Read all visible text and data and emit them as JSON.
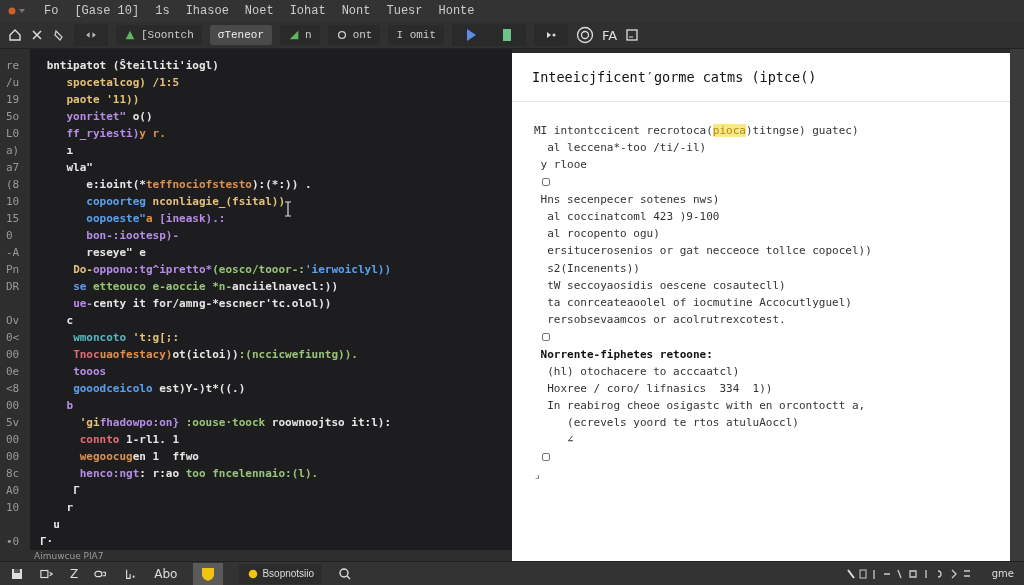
{
  "menu": [
    "Fo",
    "[Gase 10]",
    "1s",
    "Ihasoe",
    "Noet",
    "Iohat",
    "Nont",
    "Tuesr",
    "Honte"
  ],
  "toolbar": [
    {
      "label": "[Soontch",
      "selected": false
    },
    {
      "label": "σTeneor",
      "selected": true
    },
    {
      "label": "n",
      "selected": false
    },
    {
      "label": "ont",
      "selected": false
    },
    {
      "label": "I omit",
      "selected": false
    }
  ],
  "toolbar_text": "FA",
  "editor": {
    "lines": [
      {
        "gutter": "re",
        "segs": [
          {
            "t": " bntipatot (Ŝteilliti'iogl)",
            "color": "#e6e6e6"
          }
        ]
      },
      {
        "gutter": "/u",
        "segs": [
          {
            "t": "    spocetalcog) /1:5",
            "color": "#e5c07b"
          }
        ]
      },
      {
        "gutter": "19",
        "segs": [
          {
            "t": "    paote '11))",
            "color": "#e5c07b"
          }
        ]
      },
      {
        "gutter": "5o",
        "segs": [
          {
            "t": "    yonritet\"",
            "color": "#b58ce6"
          },
          {
            "t": " o()",
            "color": "#e6e6e6"
          }
        ]
      },
      {
        "gutter": "L0",
        "segs": [
          {
            "t": "    ff_ryiesti)",
            "color": "#b58ce6"
          },
          {
            "t": "y r.",
            "color": "#e0904a"
          }
        ]
      },
      {
        "gutter": "a)",
        "segs": [
          {
            "t": "    ı",
            "color": "#e6e6e6"
          }
        ]
      },
      {
        "gutter": "a7",
        "segs": [
          {
            "t": "    wla\"",
            "color": "#e6e6e6"
          }
        ]
      },
      {
        "gutter": "(8",
        "segs": [
          {
            "t": "       e:ioint(*",
            "color": "#e6e6e6"
          },
          {
            "t": "teffnociofstesto",
            "color": "#e0904a"
          },
          {
            "t": "):(*:)) .",
            "color": "#e6e6e6"
          }
        ]
      },
      {
        "gutter": "10",
        "segs": [
          {
            "t": "       copoorteg ",
            "color": "#5aa0f0"
          },
          {
            "t": "nconliagie_(fsital))",
            "color": "#e5c07b"
          }
        ]
      },
      {
        "gutter": "15",
        "segs": [
          {
            "t": "       oopoeste\"",
            "color": "#5aa0f0"
          },
          {
            "t": "a ",
            "color": "#e0904a"
          },
          {
            "t": "[ineask).:",
            "color": "#b58ce6"
          }
        ]
      },
      {
        "gutter": "0",
        "segs": [
          {
            "t": "       bon-:iootesp)-",
            "color": "#b58ce6"
          }
        ]
      },
      {
        "gutter": "-A",
        "segs": [
          {
            "t": "       reseye\" e",
            "color": "#e6e6e6"
          }
        ]
      },
      {
        "gutter": "Pn",
        "segs": [
          {
            "t": "     Do-",
            "color": "#e5c07b"
          },
          {
            "t": "oppono:tg^ipretto*",
            "color": "#b58ce6"
          },
          {
            "t": "(eosco/tooor-:",
            "color": "#98c379"
          },
          {
            "t": "'ierwoiclyl))",
            "color": "#5aa0f0"
          }
        ]
      },
      {
        "gutter": "DR",
        "segs": [
          {
            "t": "     se ",
            "color": "#5aa0f0"
          },
          {
            "t": "etteouco e-aoccie *n-",
            "color": "#98c379"
          },
          {
            "t": "anciielnavecl:))",
            "color": "#e6e6e6"
          }
        ]
      },
      {
        "segs": [
          {
            "t": "     ue-",
            "color": "#b58ce6"
          },
          {
            "t": "centy it for/amng-*escnecr'tc.olol))",
            "color": "#e6e6e6"
          }
        ]
      },
      {
        "gutter": "Ov",
        "segs": [
          {
            "t": "    c",
            "color": "#e6e6e6"
          }
        ]
      },
      {
        "gutter": "0<",
        "segs": [
          {
            "t": "     wmoncoto ",
            "color": "#56b6c2"
          },
          {
            "t": "'t:g[;:",
            "color": "#e5c07b"
          }
        ]
      },
      {
        "gutter": "00",
        "segs": [
          {
            "t": "     Tnoc",
            "color": "#e06c75"
          },
          {
            "t": "uaofestacy)",
            "color": "#e0904a"
          },
          {
            "t": "ot(icloi))",
            "color": "#e6e6e6"
          },
          {
            "t": ":(nccicwefiuntg)).",
            "color": "#98c379"
          }
        ]
      },
      {
        "gutter": "0e",
        "segs": [
          {
            "t": "     tooos",
            "color": "#b58ce6"
          }
        ]
      },
      {
        "gutter": "<8",
        "segs": [
          {
            "t": "     gooodceicolo ",
            "color": "#5aa0f0"
          },
          {
            "t": "est)Y-)t*((.)",
            "color": "#e6e6e6"
          }
        ]
      },
      {
        "gutter": "00",
        "segs": [
          {
            "t": "    b",
            "color": "#b58ce6"
          }
        ]
      },
      {
        "gutter": "5v",
        "segs": [
          {
            "t": "      'gi",
            "color": "#e5c07b"
          },
          {
            "t": "fhadowpo:on} ",
            "color": "#b58ce6"
          },
          {
            "t": ":oouse·toock ",
            "color": "#98c379"
          },
          {
            "t": "roownoojtso it:l):",
            "color": "#e6e6e6"
          }
        ]
      },
      {
        "gutter": "00",
        "segs": [
          {
            "t": "      connto ",
            "color": "#e06c75"
          },
          {
            "t": "1-rl1. 1",
            "color": "#e6e6e6"
          }
        ]
      },
      {
        "gutter": "00",
        "segs": [
          {
            "t": "      wegoocug",
            "color": "#e0904a"
          },
          {
            "t": "en 1  ffwo",
            "color": "#e6e6e6"
          }
        ]
      },
      {
        "gutter": "8c",
        "segs": [
          {
            "t": "      henco:ngt",
            "color": "#b58ce6"
          },
          {
            "t": ": r:ao ",
            "color": "#e6e6e6"
          },
          {
            "t": "too fncelennaio:(l).",
            "color": "#98c379"
          }
        ]
      },
      {
        "gutter": "A0",
        "segs": [
          {
            "t": "     Γ",
            "color": "#e6e6e6"
          }
        ]
      },
      {
        "gutter": "10",
        "segs": [
          {
            "t": "    r",
            "color": "#e6e6e6"
          }
        ]
      },
      {
        "segs": [
          {
            "t": "  u",
            "color": "#e6e6e6"
          }
        ]
      },
      {
        "gutter": "•0",
        "segs": [
          {
            "t": "Γ·",
            "color": "#e6e6e6"
          }
        ]
      }
    ],
    "status": "Aimuwcue PIA7"
  },
  "panel": {
    "title": "Inteeicjficent′gorme catms  (iptce()",
    "lines": [
      {
        "kind": "text",
        "segs": [
          {
            "t": "MI intontccicent recrotoca(",
            "highlighted": false
          },
          {
            "t": "pioca",
            "highlighted": true
          },
          {
            "t": ")titngse) guatec)",
            "highlighted": false
          }
        ]
      },
      {
        "kind": "text",
        "segs": [
          {
            "t": "  al leccena*-too /ti/-il)",
            "highlighted": false
          }
        ]
      },
      {
        "kind": "text",
        "segs": [
          {
            "t": " y rlooe",
            "highlighted": false
          }
        ]
      },
      {
        "kind": "box"
      },
      {
        "kind": "text",
        "segs": [
          {
            "t": " Hns secenpecer sotenes nws)",
            "highlighted": false
          }
        ]
      },
      {
        "kind": "text",
        "segs": [
          {
            "t": "  al coccinatcoml 423 )9-100",
            "highlighted": false
          }
        ]
      },
      {
        "kind": "text",
        "segs": [
          {
            "t": "  al rocopento ogu)",
            "highlighted": false
          }
        ]
      },
      {
        "kind": "text",
        "segs": [
          {
            "t": "  ersitucerosenios or gat necceoce tollce copocel))",
            "highlighted": false
          }
        ]
      },
      {
        "kind": "text",
        "segs": [
          {
            "t": "  s2(Incenents))",
            "highlighted": false
          }
        ]
      },
      {
        "kind": "text",
        "segs": [
          {
            "t": "  tW seccoyaosidis oescene cosautecll)",
            "highlighted": false
          }
        ]
      },
      {
        "kind": "text",
        "segs": [
          {
            "t": "  ta conrceateaoolel of iocmutine Accocutlyguel)",
            "highlighted": false
          }
        ]
      },
      {
        "kind": "text",
        "segs": [
          {
            "t": "  rersobsevaamcos or acolrutrexcotest.",
            "highlighted": false
          }
        ]
      },
      {
        "kind": "box"
      },
      {
        "kind": "heading",
        "segs": [
          {
            "t": " Norrente-fiphetes retoone:",
            "highlighted": false
          }
        ]
      },
      {
        "kind": "text",
        "segs": [
          {
            "t": "  (hl) otochacere to acccaatcl)",
            "highlighted": false
          }
        ]
      },
      {
        "kind": "text",
        "segs": [
          {
            "t": "  Hoxree / coro/ lifnasics  334  1))",
            "highlighted": false
          }
        ]
      },
      {
        "kind": "text",
        "segs": [
          {
            "t": "  In reabirog cheoe osigastc with en orcontoctt a,",
            "highlighted": false
          }
        ]
      },
      {
        "kind": "text",
        "segs": [
          {
            "t": "     (ecrevels yoord te rtos atuluAoccl)",
            "highlighted": false
          }
        ]
      },
      {
        "kind": "text",
        "segs": [
          {
            "t": "     ∠",
            "highlighted": false
          }
        ]
      },
      {
        "kind": "box"
      },
      {
        "kind": "text",
        "segs": [
          {
            "t": "⌟",
            "highlighted": false
          }
        ]
      }
    ]
  },
  "taskbar": {
    "items": [
      "Z",
      "Abo",
      "Bsopnotsiio"
    ],
    "tray_text": "gme"
  }
}
